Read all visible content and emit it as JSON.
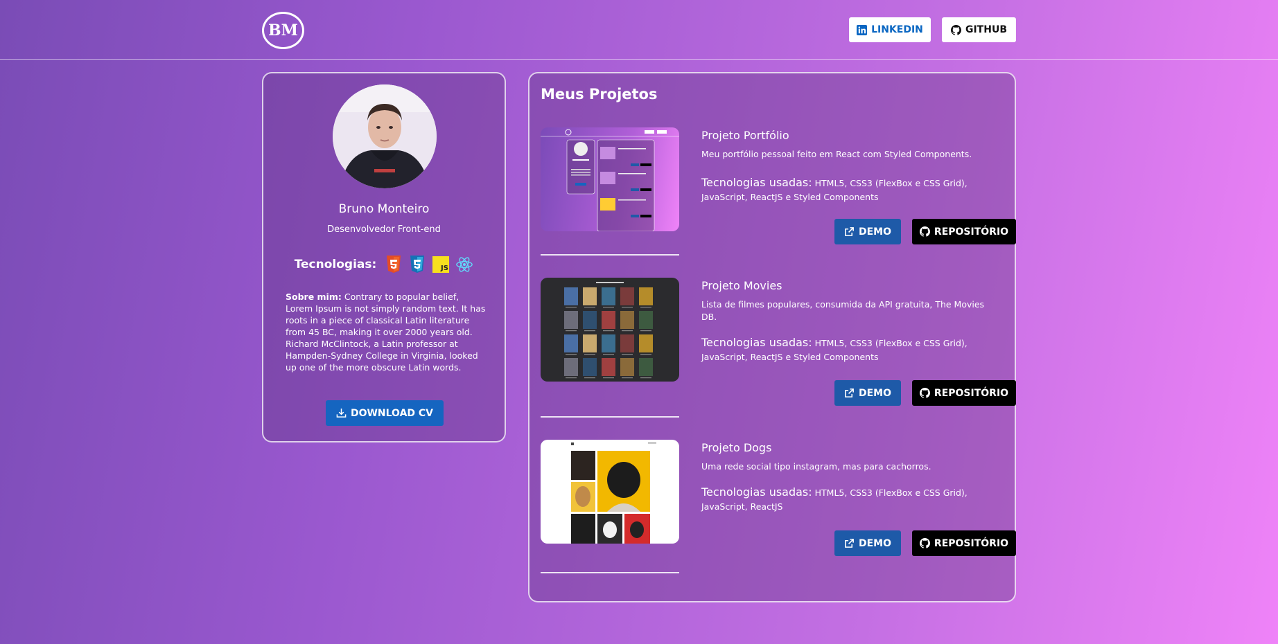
{
  "header": {
    "logo_text": "BM",
    "linkedin_label": "LINKEDIN",
    "github_label": "GITHUB"
  },
  "profile": {
    "name": "Bruno Monteiro",
    "role": "Desenvolvedor Front-end",
    "tech_label": "Tecnologias:",
    "tech_icons": [
      "html5-icon",
      "css3-icon",
      "javascript-icon",
      "react-icon"
    ],
    "about_label": "Sobre mim:",
    "about_text": "Contrary to popular belief, Lorem Ipsum is not simply random text. It has roots in a piece of classical Latin literature from 45 BC, making it over 2000 years old. Richard McClintock, a Latin professor at Hampden-Sydney College in Virginia, looked up one of the more obscure Latin words.",
    "cv_label": "DOWNLOAD CV"
  },
  "projects": {
    "title": "Meus Projetos",
    "tech_label": "Tecnologias usadas:",
    "demo_label": "DEMO",
    "repo_label": "REPOSITÓRIO",
    "items": [
      {
        "title": "Projeto Portfólio",
        "description": "Meu portfólio pessoal feito em React com Styled Components.",
        "tech": "HTML5, CSS3 (FlexBox e CSS Grid), JavaScript, ReactJS e Styled Components"
      },
      {
        "title": "Projeto Movies",
        "description": "Lista de filmes populares, consumida da API gratuita, The Movies DB.",
        "tech": "HTML5, CSS3 (FlexBox e CSS Grid), JavaScript, ReactJS e Styled Components"
      },
      {
        "title": "Projeto Dogs",
        "description": "Uma rede social tipo instagram, mas para cachorros.",
        "tech": "HTML5, CSS3 (FlexBox e CSS Grid), JavaScript, ReactJS"
      }
    ]
  },
  "colors": {
    "demo_button": "#1e5aa8",
    "repo_button": "#000000",
    "cv_button": "#1565c0",
    "linkedin_text": "#0a66c2"
  }
}
